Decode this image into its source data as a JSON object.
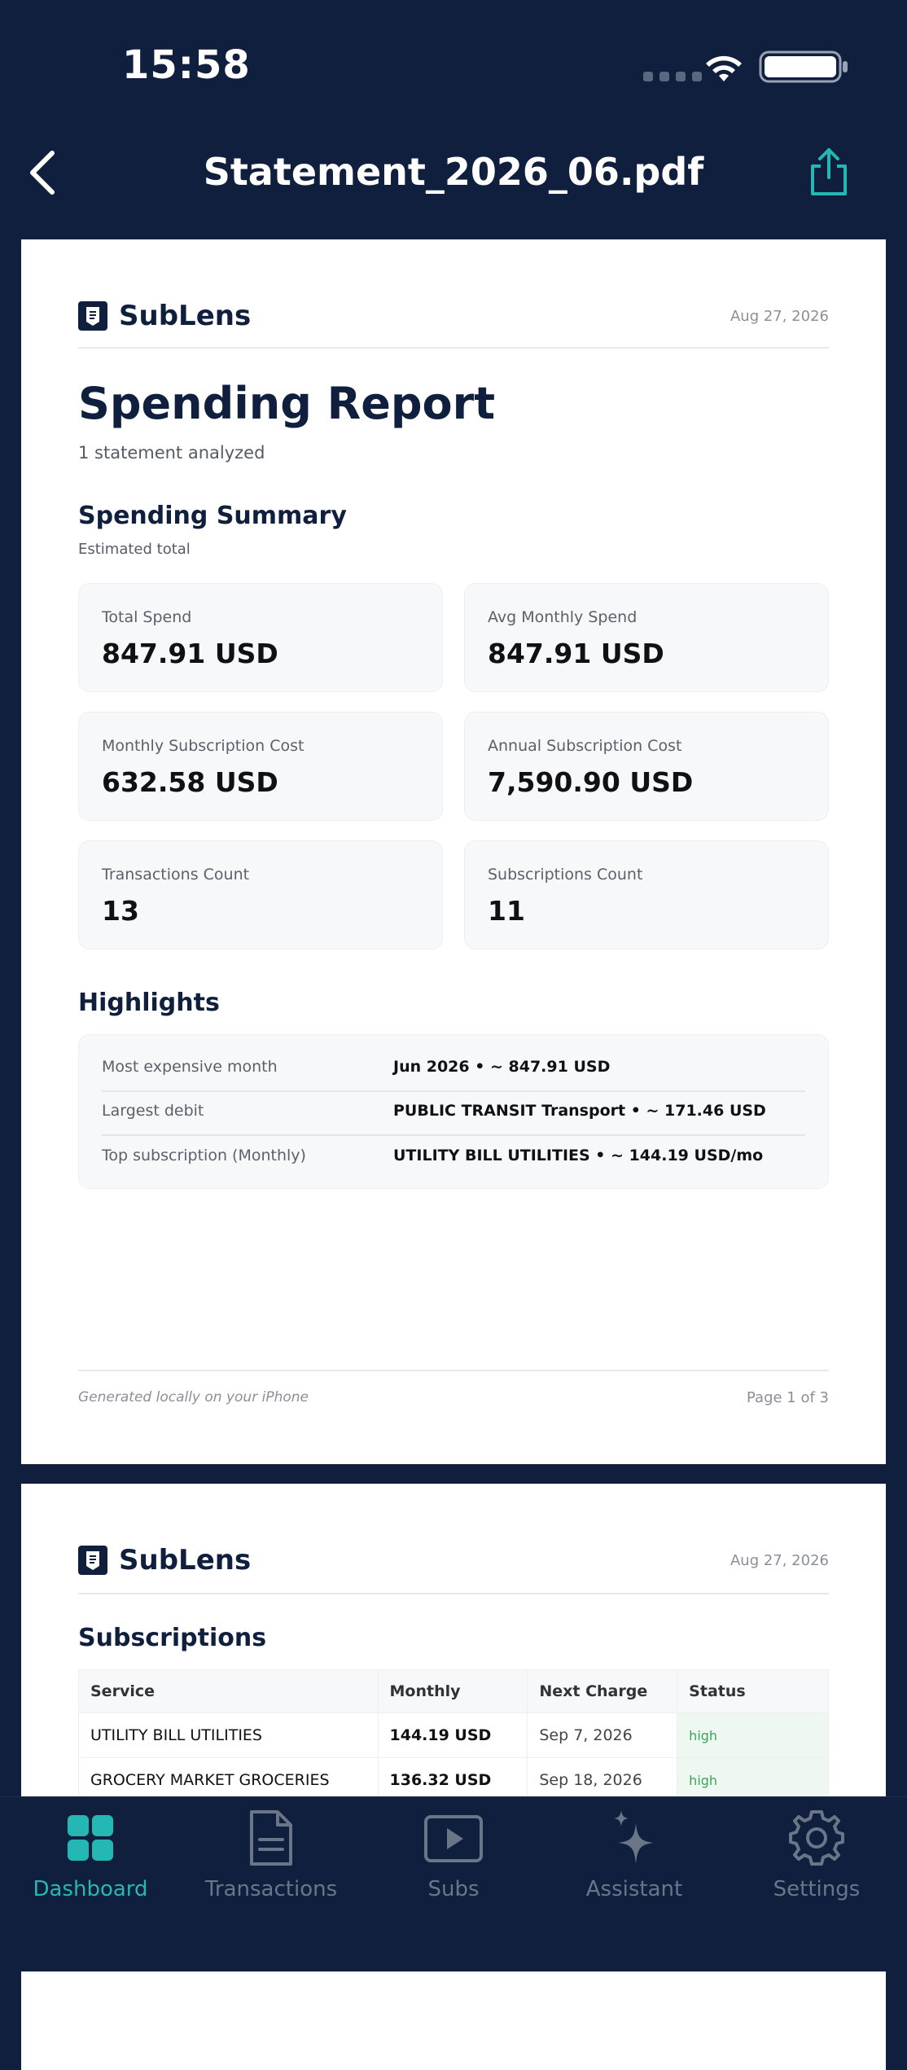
{
  "status_bar": {
    "time": "15:58"
  },
  "nav": {
    "title": "Statement_2026_06.pdf"
  },
  "page1": {
    "brand": "SubLens",
    "date": "Aug 27, 2026",
    "title": "Spending Report",
    "subtitle": "1 statement analyzed",
    "summary_title": "Spending Summary",
    "summary_note": "Estimated total",
    "cards": [
      {
        "label": "Total Spend",
        "value": "847.91 USD"
      },
      {
        "label": "Avg Monthly Spend",
        "value": "847.91 USD"
      },
      {
        "label": "Monthly Subscription Cost",
        "value": "632.58 USD"
      },
      {
        "label": "Annual Subscription Cost",
        "value": "7,590.90 USD"
      },
      {
        "label": "Transactions Count",
        "value": "13"
      },
      {
        "label": "Subscriptions Count",
        "value": "11"
      }
    ],
    "highlights_title": "Highlights",
    "highlights": [
      {
        "key": "Most expensive month",
        "value": "Jun 2026 • ~ 847.91 USD"
      },
      {
        "key": "Largest debit",
        "value": "PUBLIC TRANSIT Transport • ~ 171.46 USD"
      },
      {
        "key": "Top subscription (Monthly)",
        "value": "UTILITY BILL UTILITIES • ~ 144.19 USD/mo"
      }
    ],
    "footer_note": "Generated locally on your iPhone",
    "footer_page": "Page 1 of 3"
  },
  "page2": {
    "brand": "SubLens",
    "date": "Aug 27, 2026",
    "section_title": "Subscriptions",
    "columns": [
      "Service",
      "Monthly",
      "Next Charge",
      "Status"
    ],
    "rows": [
      {
        "service": "UTILITY BILL UTILITIES",
        "monthly": "144.19 USD",
        "next": "Sep 7, 2026",
        "status": "high"
      },
      {
        "service": "GROCERY MARKET GROCERIES",
        "monthly": "136.32 USD",
        "next": "Sep 18, 2026",
        "status": "high"
      }
    ]
  },
  "tabbar": {
    "tabs": [
      {
        "label": "Dashboard",
        "icon": "dashboard-grid-icon"
      },
      {
        "label": "Transactions",
        "icon": "document-icon"
      },
      {
        "label": "Subs",
        "icon": "play-square-icon"
      },
      {
        "label": "Assistant",
        "icon": "sparkles-icon"
      },
      {
        "label": "Settings",
        "icon": "gear-icon"
      }
    ],
    "active_color": "#23b8b3",
    "inactive_color": "#6b7588"
  }
}
